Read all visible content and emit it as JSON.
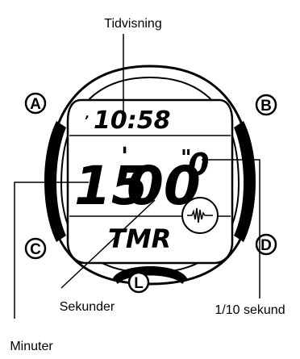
{
  "labels": {
    "top": "Tidvisning",
    "seconds": "Sekunder",
    "tenths": "1/10 sekund",
    "minutes": "Minuter"
  },
  "buttons": {
    "a": "A",
    "b": "B",
    "c": "C",
    "d": "D",
    "l": "L"
  },
  "display": {
    "time": "10:58",
    "minutes": "15",
    "seconds": "00",
    "tenths": "0",
    "mode": "TMR"
  }
}
